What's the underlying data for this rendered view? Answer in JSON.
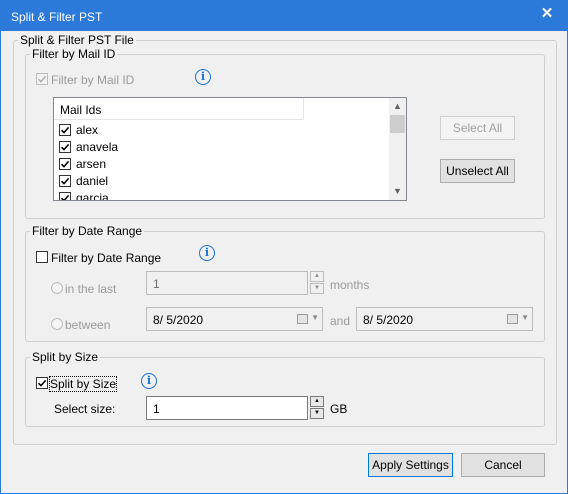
{
  "window": {
    "title": "Split & Filter PST",
    "close_glyph": "✕"
  },
  "group_main": {
    "label": "Split & Filter PST File"
  },
  "mail_filter": {
    "legend": "Filter by Mail ID",
    "checkbox_label": "Filter by Mail ID",
    "checked": true,
    "info_icon": "info-icon",
    "list_header": "Mail Ids",
    "items": [
      {
        "name": "alex",
        "checked": true
      },
      {
        "name": "anavela",
        "checked": true
      },
      {
        "name": "arsen",
        "checked": true
      },
      {
        "name": "daniel",
        "checked": true
      },
      {
        "name": "garcia",
        "checked": true
      }
    ],
    "select_all_label": "Select All",
    "unselect_all_label": "Unselect All"
  },
  "date_filter": {
    "legend": "Filter by Date Range",
    "checkbox_label": "Filter by Date Range",
    "checked": false,
    "in_the_last_label": "in the last",
    "in_the_last_value": "1",
    "months_label": "months",
    "between_label": "between",
    "start_date": "8/  5/2020",
    "and_label": "and",
    "end_date": "8/  5/2020"
  },
  "split_size": {
    "legend": "Split by Size",
    "checkbox_label": "Split by Size",
    "checked": true,
    "select_size_label": "Select size:",
    "size_value": "1",
    "unit_label": "GB"
  },
  "footer": {
    "apply_label": "Apply Settings",
    "cancel_label": "Cancel"
  }
}
